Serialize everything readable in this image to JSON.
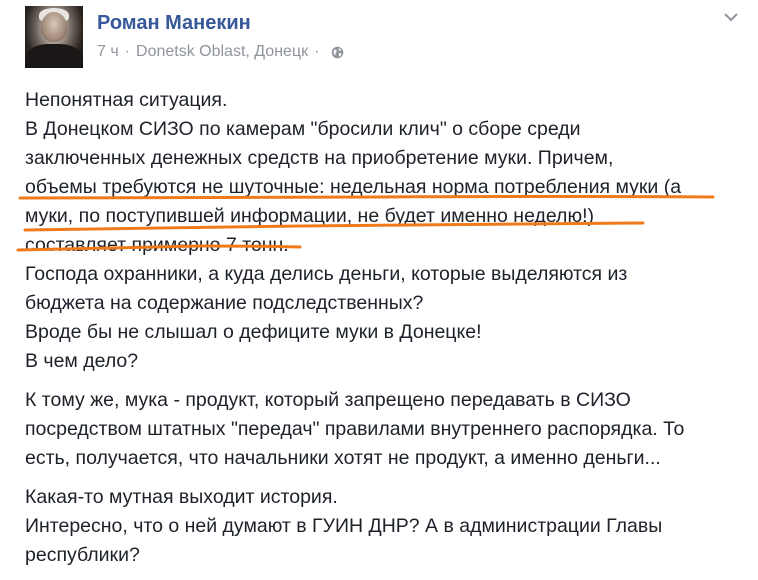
{
  "post": {
    "author": "Роман Манекин",
    "time": "7 ч",
    "separator": "·",
    "location": "Donetsk Oblast, Донецк",
    "separator2": "·",
    "privacy_icon": "globe-icon",
    "menu_icon": "chevron-down-icon",
    "paragraphs": [
      [
        "Непонятная ситуация.",
        "В Донецком СИЗО по камерам \"бросили клич\" о сборе среди",
        "заключенных денежных средств на приобретение муки. Причем,",
        "объемы требуются не шуточные: недельная норма потребления муки (а",
        "муки, по поступившей информации, не будет именно неделю!)",
        "составляет примерно 7 тонн.",
        "Господа охранники, а куда делись деньги, которые выделяются из",
        "бюджета на содержание подследственных?",
        "Вроде бы не слышал о дефиците муки в Донецке!",
        "В чем дело?"
      ],
      [
        "К тому же, мука - продукт, который запрещено передавать в СИЗО",
        "посредством штатных \"передач\" правилами внутреннего распорядка. То",
        "есть, получается, что начальники хотят не продукт, а именно деньги..."
      ],
      [
        "Какая-то мутная выходит история.",
        "Интересно, что о ней думают в ГУИН ДНР? А в администрации Главы",
        "республики?"
      ]
    ],
    "highlight_color": "#f07a1a",
    "author_color": "#365899",
    "meta_color": "#90949c"
  }
}
